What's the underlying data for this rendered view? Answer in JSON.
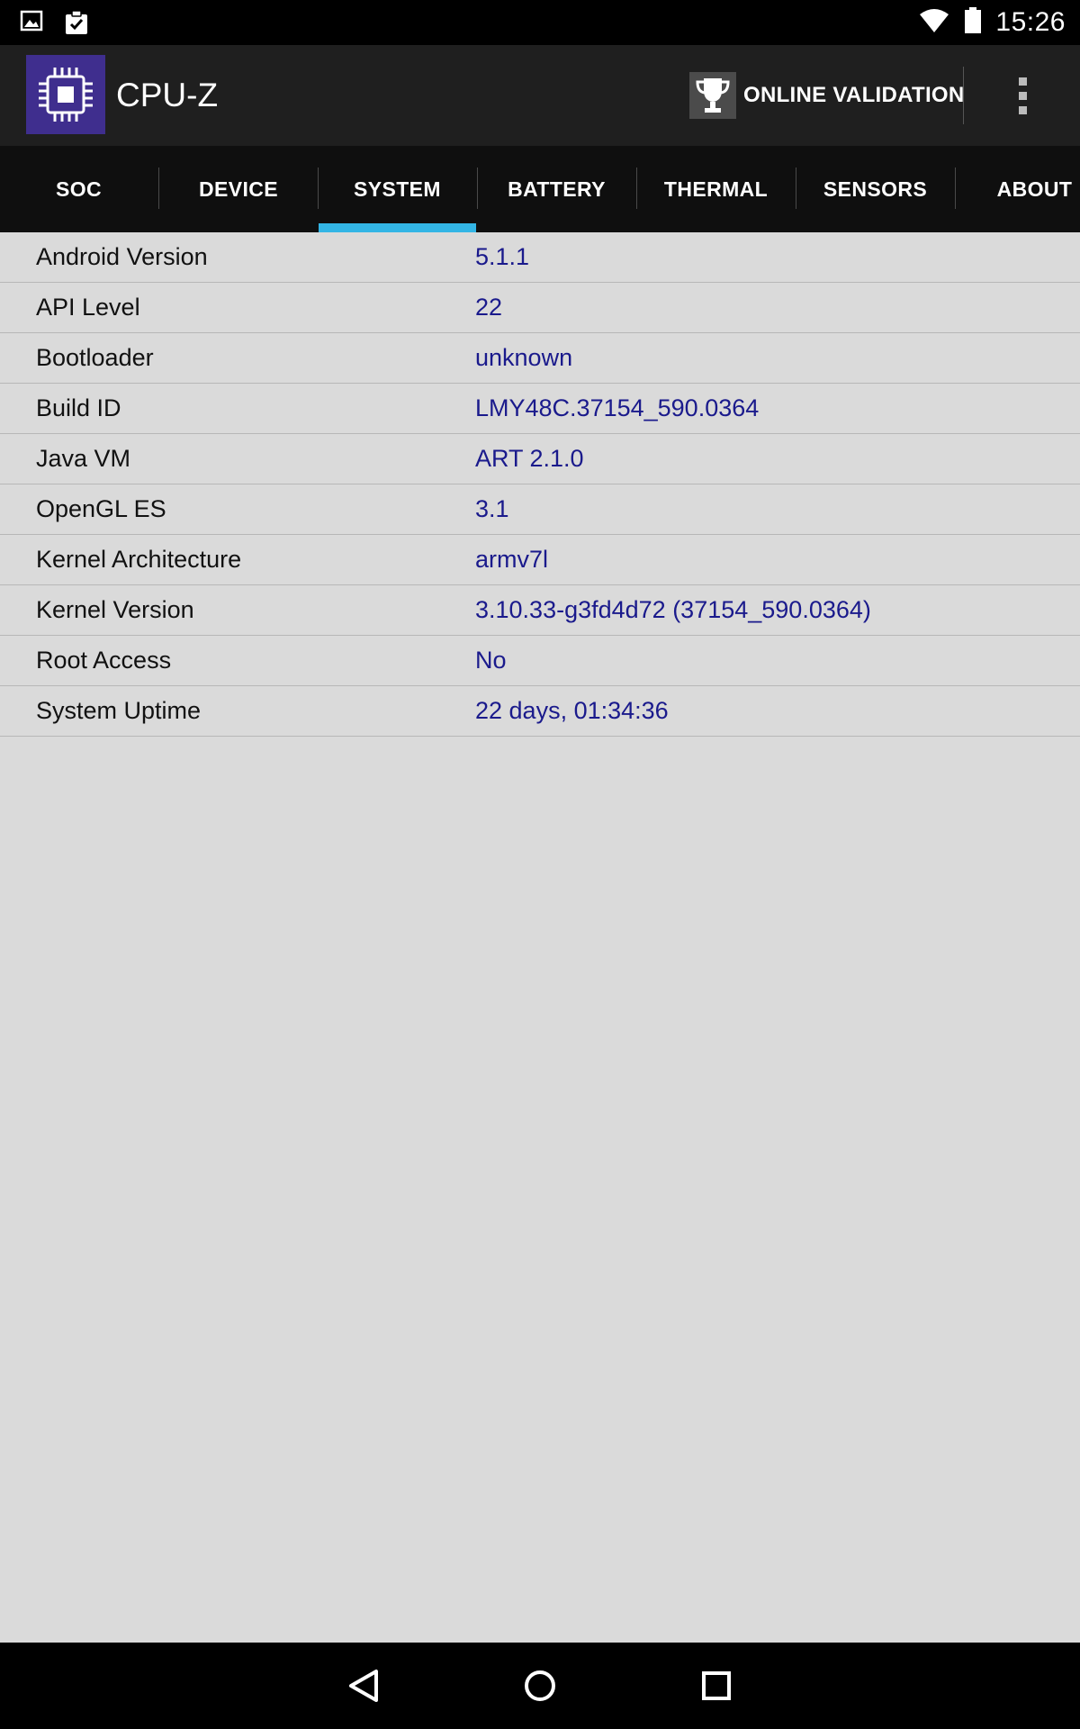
{
  "status_bar": {
    "time": "15:26",
    "left_icons": [
      "gallery-icon",
      "task-clipboard-icon"
    ],
    "right_icons": [
      "wifi-icon",
      "battery-icon"
    ]
  },
  "app_bar": {
    "title": "CPU-Z",
    "validation_label": "ONLINE VALIDATION",
    "icons": [
      "cpu-chip-logo-icon",
      "trophy-icon",
      "overflow-menu-icon"
    ]
  },
  "tabs": [
    {
      "label": "SOC"
    },
    {
      "label": "DEVICE"
    },
    {
      "label": "SYSTEM",
      "active": true
    },
    {
      "label": "BATTERY"
    },
    {
      "label": "THERMAL"
    },
    {
      "label": "SENSORS"
    },
    {
      "label": "ABOUT"
    }
  ],
  "system_info": [
    {
      "label": "Android Version",
      "value": "5.1.1"
    },
    {
      "label": "API Level",
      "value": "22"
    },
    {
      "label": "Bootloader",
      "value": "unknown"
    },
    {
      "label": "Build ID",
      "value": "LMY48C.37154_590.0364"
    },
    {
      "label": "Java VM",
      "value": "ART 2.1.0"
    },
    {
      "label": "OpenGL ES",
      "value": "3.1"
    },
    {
      "label": "Kernel Architecture",
      "value": "armv7l"
    },
    {
      "label": "Kernel Version",
      "value": "3.10.33-g3fd4d72 (37154_590.0364)"
    },
    {
      "label": "Root Access",
      "value": "No"
    },
    {
      "label": "System Uptime",
      "value": "22 days, 01:34:36"
    }
  ],
  "nav_bar": {
    "icons": [
      "back-icon",
      "home-icon",
      "recents-icon"
    ]
  },
  "colors": {
    "accent": "#33b5e5",
    "value_text": "#1a1a8c",
    "logo_bg": "#3f2e8e",
    "app_bar_bg": "#1f1f1f",
    "tab_bar_bg": "#0f0f0f",
    "content_bg": "#dadada"
  }
}
